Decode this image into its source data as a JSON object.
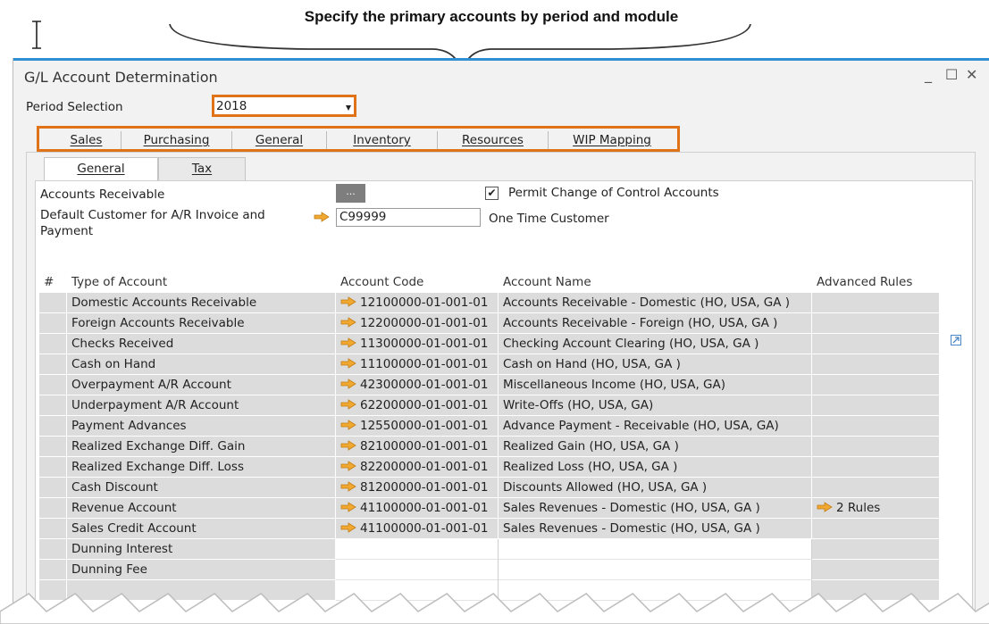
{
  "annotation": {
    "title": "Specify the primary accounts by period and module"
  },
  "window": {
    "title": "G/L Account Determination",
    "minimize": "_",
    "maximize": "☐",
    "close": "✕"
  },
  "period": {
    "label": "Period Selection",
    "value": "2018"
  },
  "module_tabs": [
    {
      "label": "Sales",
      "active": true
    },
    {
      "label": "Purchasing",
      "active": false
    },
    {
      "label": "General",
      "active": false
    },
    {
      "label": "Inventory",
      "active": false
    },
    {
      "label": "Resources",
      "active": false
    },
    {
      "label": "WIP Mapping",
      "active": false
    }
  ],
  "sub_tabs": [
    {
      "label": "General",
      "active": true
    },
    {
      "label": "Tax",
      "active": false
    }
  ],
  "form": {
    "accounts_receivable_label": "Accounts Receivable",
    "ellipsis": "...",
    "permit_change_label": "Permit Change of Control Accounts",
    "permit_change_checked": true,
    "default_customer_label_line1": "Default Customer for A/R Invoice and",
    "default_customer_label_line2": "Payment",
    "default_customer_value": "C99999",
    "default_customer_name": "One Time Customer"
  },
  "grid": {
    "headers": [
      "#",
      "Type of Account",
      "Account Code",
      "Account Name",
      "Advanced Rules"
    ],
    "rows": [
      {
        "type": "Domestic Accounts Receivable",
        "code": "12100000-01-001-01",
        "name": "Accounts Receivable - Domestic (HO, USA, GA )",
        "rules": ""
      },
      {
        "type": "Foreign Accounts Receivable",
        "code": "12200000-01-001-01",
        "name": "Accounts Receivable - Foreign (HO, USA, GA )",
        "rules": ""
      },
      {
        "type": "Checks Received",
        "code": "11300000-01-001-01",
        "name": "Checking Account Clearing (HO, USA, GA )",
        "rules": ""
      },
      {
        "type": "Cash on Hand",
        "code": "11100000-01-001-01",
        "name": "Cash on Hand (HO, USA, GA )",
        "rules": ""
      },
      {
        "type": "Overpayment A/R Account",
        "code": "42300000-01-001-01",
        "name": "Miscellaneous Income (HO, USA, GA)",
        "rules": ""
      },
      {
        "type": "Underpayment A/R Account",
        "code": "62200000-01-001-01",
        "name": "Write-Offs (HO, USA, GA)",
        "rules": ""
      },
      {
        "type": "Payment Advances",
        "code": "12550000-01-001-01",
        "name": "Advance Payment - Receivable (HO, USA, GA)",
        "rules": ""
      },
      {
        "type": "Realized Exchange Diff. Gain",
        "code": "82100000-01-001-01",
        "name": "Realized Gain (HO, USA, GA )",
        "rules": ""
      },
      {
        "type": "Realized Exchange Diff. Loss",
        "code": "82200000-01-001-01",
        "name": "Realized Loss (HO, USA, GA )",
        "rules": ""
      },
      {
        "type": "Cash Discount",
        "code": "81200000-01-001-01",
        "name": "Discounts Allowed (HO, USA, GA )",
        "rules": ""
      },
      {
        "type": "Revenue Account",
        "code": "41100000-01-001-01",
        "name": "Sales Revenues - Domestic (HO, USA, GA )",
        "rules": "2 Rules"
      },
      {
        "type": "Sales Credit Account",
        "code": "41100000-01-001-01",
        "name": "Sales Revenues - Domestic (HO, USA, GA )",
        "rules": ""
      },
      {
        "type": "Dunning Interest",
        "code": "",
        "name": "",
        "rules": ""
      },
      {
        "type": "Dunning Fee",
        "code": "",
        "name": "",
        "rules": ""
      },
      {
        "type": "",
        "code": "",
        "name": "",
        "rules": ""
      }
    ]
  },
  "colors": {
    "accent_orange": "#e07318",
    "link_arrow": "#f0a830",
    "window_accent": "#2f8fd3"
  }
}
